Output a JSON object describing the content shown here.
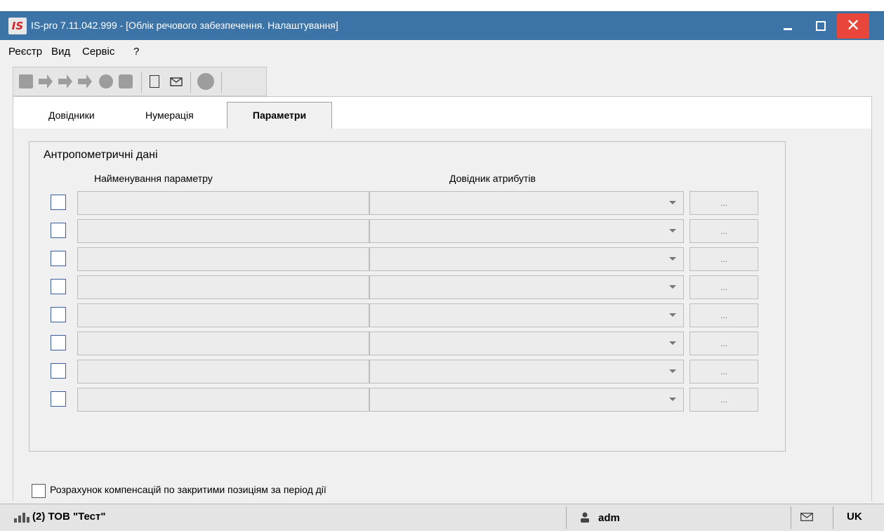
{
  "window": {
    "logo_text": "IS",
    "title": "IS-pro 7.11.042.999 - [Облік речового забезпечення. Налаштування]",
    "close_glyph": "✕"
  },
  "menu": [
    "Реєстр",
    "Вид",
    "Сервіс",
    "?"
  ],
  "toolbar_icons": [
    "folder-icon",
    "arrow-icon",
    "arrow-icon",
    "arrow-icon",
    "gear-icon",
    "printer-icon",
    "document-icon",
    "mail-icon",
    "circle-icon"
  ],
  "tabs": {
    "items": [
      "Довідники",
      "Нумерація",
      "Параметри"
    ],
    "active": "Параметри"
  },
  "group": {
    "title": "Антропометричні дані",
    "col_name": "Найменування параметру",
    "col_attr": "Довідник атрибутів",
    "ellipsis": "...",
    "rows": [
      {
        "name": "",
        "attr": ""
      },
      {
        "name": "",
        "attr": ""
      },
      {
        "name": "",
        "attr": ""
      },
      {
        "name": "",
        "attr": ""
      },
      {
        "name": "",
        "attr": ""
      },
      {
        "name": "",
        "attr": ""
      },
      {
        "name": "",
        "attr": ""
      },
      {
        "name": "",
        "attr": ""
      }
    ]
  },
  "compensation_label": "Розрахунок компенсацій по закритими позиціям за період дії",
  "status": {
    "org": "(2) ТОВ \"Тест\"",
    "user": "adm",
    "lang": "UK"
  },
  "colors": {
    "titlebar": "#3c74a8",
    "close": "#e8453b",
    "logo": "#d0262b"
  }
}
